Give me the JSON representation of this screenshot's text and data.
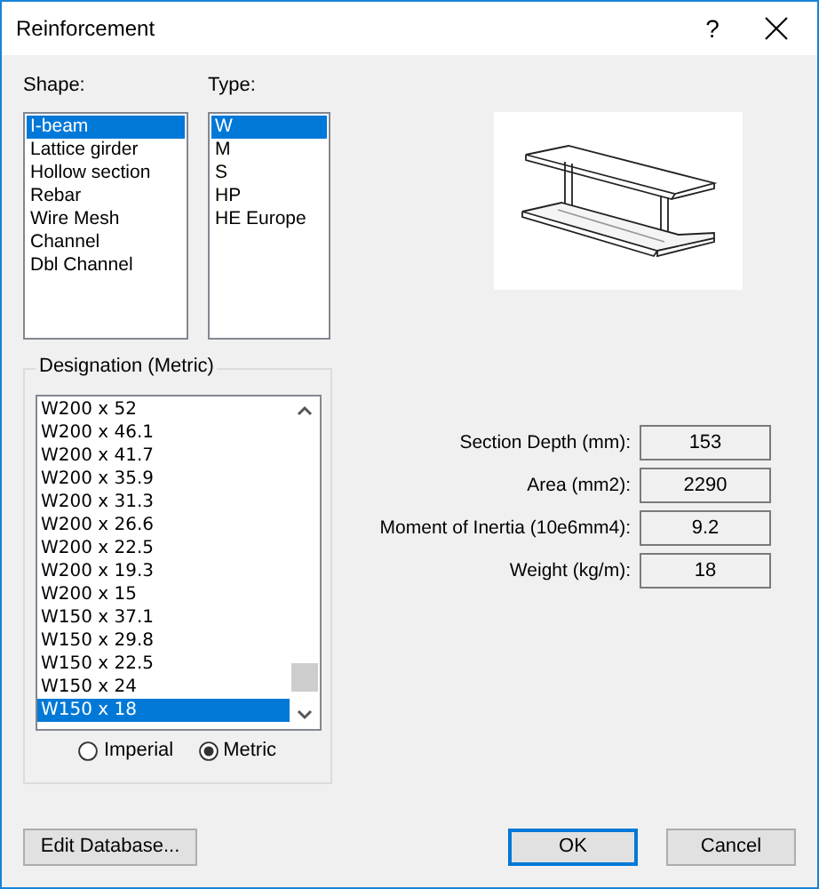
{
  "window": {
    "title": "Reinforcement",
    "help": "?"
  },
  "shape": {
    "label": "Shape:",
    "items": [
      {
        "label": "I-beam",
        "selected": true
      },
      {
        "label": "Lattice girder",
        "selected": false
      },
      {
        "label": "Hollow section",
        "selected": false
      },
      {
        "label": "Rebar",
        "selected": false
      },
      {
        "label": "Wire Mesh",
        "selected": false
      },
      {
        "label": "Channel",
        "selected": false
      },
      {
        "label": "Dbl Channel",
        "selected": false
      }
    ]
  },
  "type": {
    "label": "Type:",
    "items": [
      {
        "label": "W",
        "selected": true
      },
      {
        "label": "M",
        "selected": false
      },
      {
        "label": "S",
        "selected": false
      },
      {
        "label": "HP",
        "selected": false
      },
      {
        "label": "HE Europe",
        "selected": false
      }
    ]
  },
  "designation": {
    "title": "Designation (Metric)",
    "items": [
      {
        "label": "W200 x 52",
        "selected": false
      },
      {
        "label": "W200 x 46.1",
        "selected": false
      },
      {
        "label": "W200 x 41.7",
        "selected": false
      },
      {
        "label": "W200 x 35.9",
        "selected": false
      },
      {
        "label": "W200 x 31.3",
        "selected": false
      },
      {
        "label": "W200 x 26.6",
        "selected": false
      },
      {
        "label": "W200 x 22.5",
        "selected": false
      },
      {
        "label": "W200 x 19.3",
        "selected": false
      },
      {
        "label": "W200 x 15",
        "selected": false
      },
      {
        "label": "W150 x 37.1",
        "selected": false
      },
      {
        "label": "W150 x 29.8",
        "selected": false
      },
      {
        "label": "W150 x 22.5",
        "selected": false
      },
      {
        "label": "W150 x 24",
        "selected": false
      },
      {
        "label": "W150 x 18",
        "selected": true
      }
    ],
    "units": [
      {
        "label": "Imperial",
        "selected": false
      },
      {
        "label": "Metric",
        "selected": true
      }
    ]
  },
  "properties": [
    {
      "label": "Section Depth (mm):",
      "value": "153"
    },
    {
      "label": "Area (mm2):",
      "value": "2290"
    },
    {
      "label": "Moment of Inertia (10e6mm4):",
      "value": "9.2"
    },
    {
      "label": "Weight (kg/m):",
      "value": "18"
    }
  ],
  "buttons": [
    {
      "label": "Edit Database...",
      "default": false
    },
    {
      "label": "OK",
      "default": true
    },
    {
      "label": "Cancel",
      "default": false
    }
  ]
}
